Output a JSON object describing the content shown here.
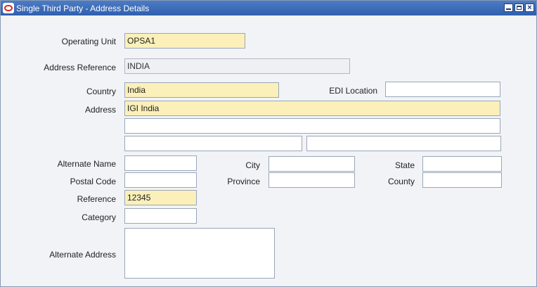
{
  "window": {
    "title": "Single Third Party - Address Details",
    "close_glyph": "×"
  },
  "form": {
    "operating_unit": {
      "label": "Operating Unit",
      "value": "OPSA1"
    },
    "address_reference": {
      "label": "Address Reference",
      "value": "INDIA"
    },
    "country": {
      "label": "Country",
      "value": "India"
    },
    "edi_location": {
      "label": "EDI Location",
      "value": ""
    },
    "address": {
      "label": "Address",
      "line1": "IGI India",
      "line2": "",
      "line3a": "",
      "line3b": ""
    },
    "alternate_name": {
      "label": "Alternate Name",
      "value": ""
    },
    "city": {
      "label": "City",
      "value": ""
    },
    "state": {
      "label": "State",
      "value": ""
    },
    "postal_code": {
      "label": "Postal Code",
      "value": ""
    },
    "province": {
      "label": "Province",
      "value": ""
    },
    "county": {
      "label": "County",
      "value": ""
    },
    "reference": {
      "label": "Reference",
      "value": "12345"
    },
    "category": {
      "label": "Category",
      "value": ""
    },
    "alternate_address": {
      "label": "Alternate Address",
      "value": ""
    }
  },
  "colors": {
    "required_field": "#fbf0b9",
    "titlebar": "#3a6bb8",
    "background": "#f1f3f6"
  }
}
